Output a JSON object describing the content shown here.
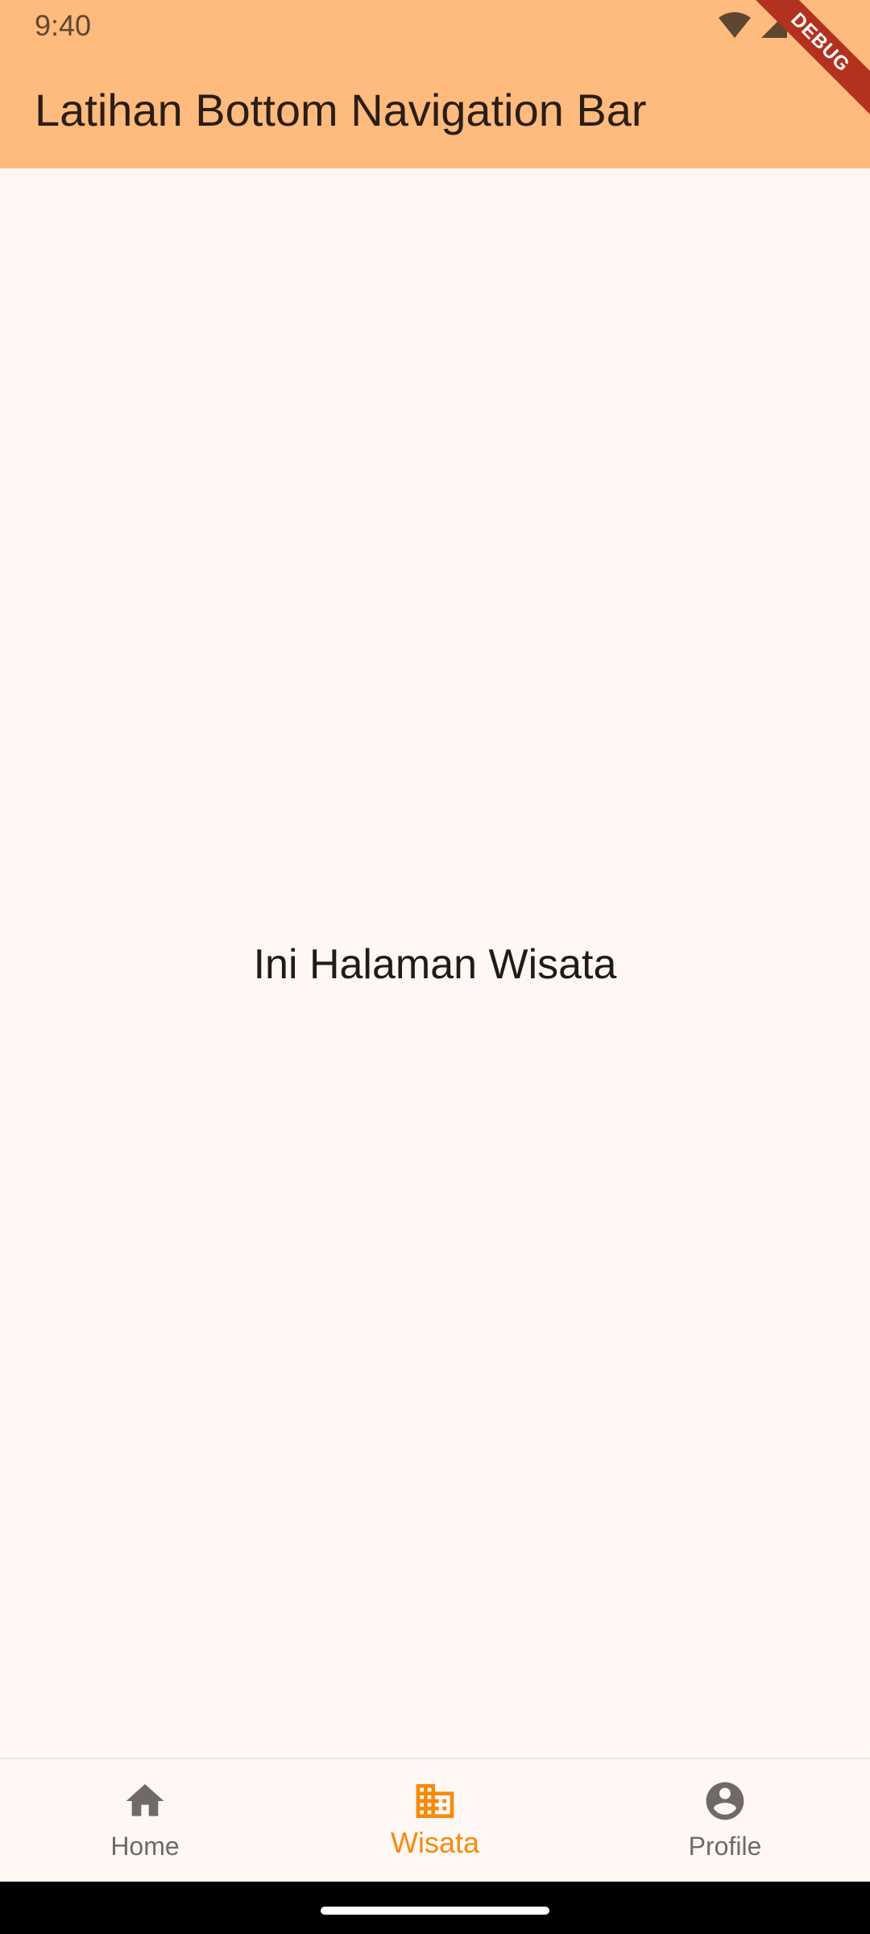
{
  "status_bar": {
    "time": "9:40",
    "icons": [
      "wifi-icon",
      "signal-icon",
      "battery-icon"
    ]
  },
  "debug_banner": {
    "label": "DEBUG"
  },
  "app_bar": {
    "title": "Latihan Bottom Navigation Bar",
    "background_color": "#FFBA7D"
  },
  "content": {
    "message": "Ini Halaman Wisata"
  },
  "bottom_nav": {
    "active_color": "#F58B0C",
    "inactive_color": "#6F6A67",
    "items": [
      {
        "label": "Home",
        "icon": "home-icon",
        "active": false
      },
      {
        "label": "Wisata",
        "icon": "building-icon",
        "active": true
      },
      {
        "label": "Profile",
        "icon": "account-circle-icon",
        "active": false
      }
    ]
  }
}
